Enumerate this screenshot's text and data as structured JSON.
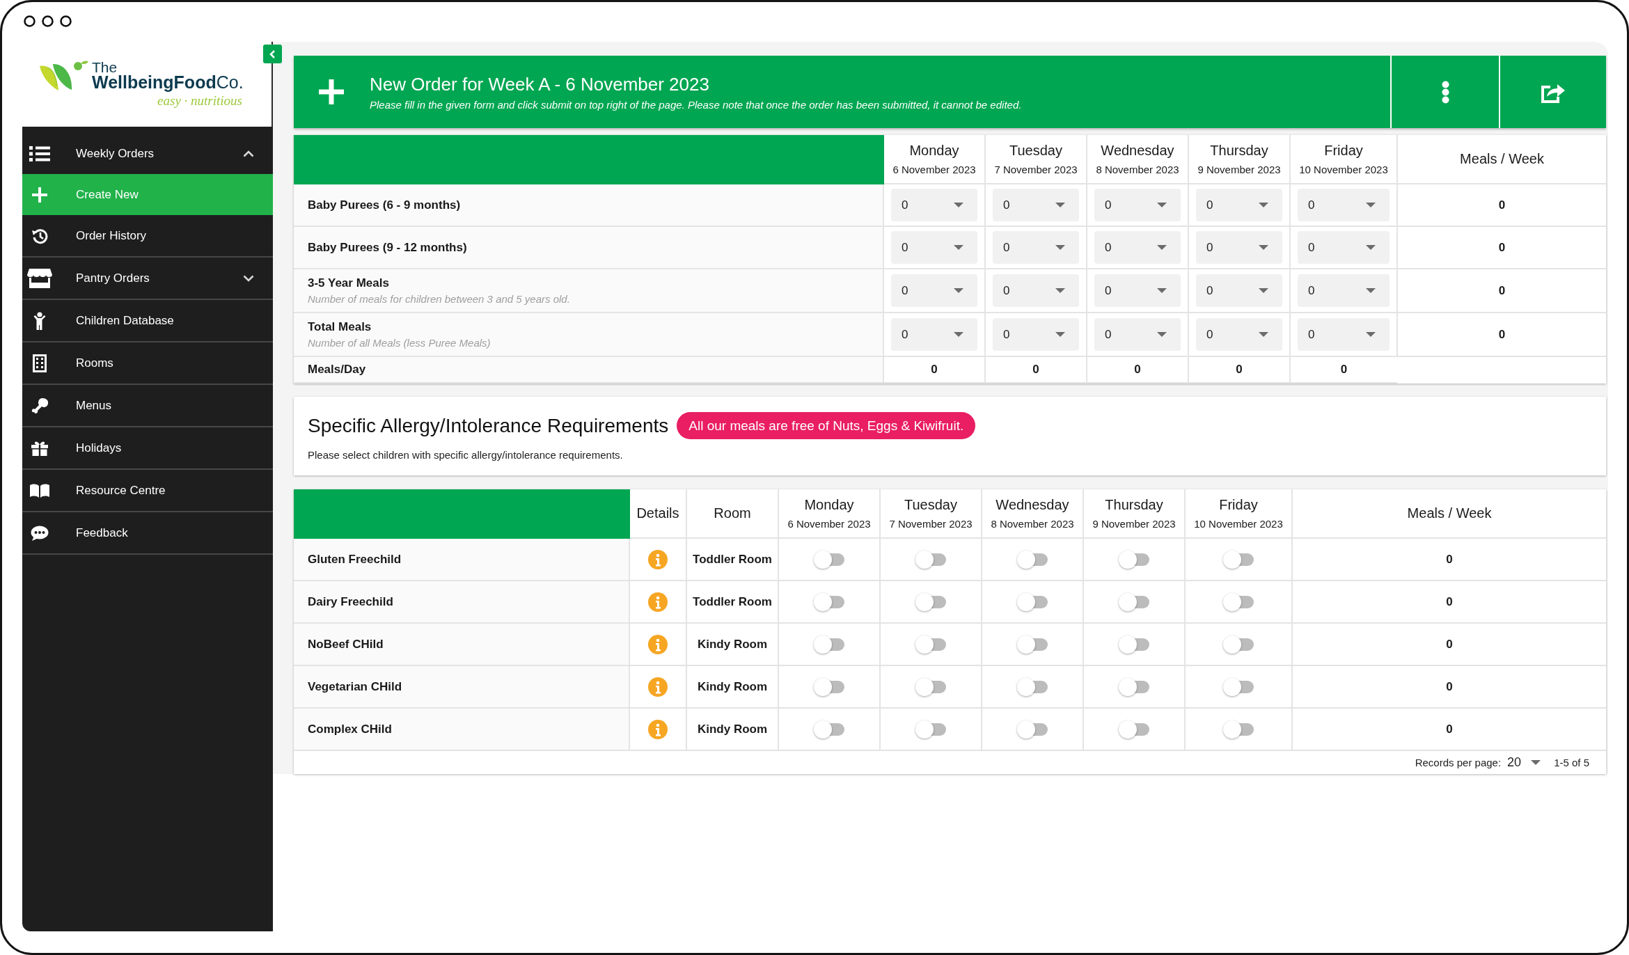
{
  "logo": {
    "name_small": "The",
    "name": "**WellbeingFood**Co.",
    "tagline": "easy · nutritious"
  },
  "sidebar": {
    "items": [
      {
        "kind": "group",
        "label": "Weekly Orders",
        "selected": false,
        "expanded": true,
        "children": [
          {
            "label": "Create New",
            "selected": true
          },
          {
            "label": "Order History",
            "selected": false
          }
        ]
      },
      {
        "kind": "group",
        "label": "Pantry Orders",
        "selected": false,
        "expanded": false
      },
      {
        "kind": "link",
        "label": "Children Database",
        "selected": false
      },
      {
        "kind": "link",
        "label": "Rooms",
        "selected": false
      },
      {
        "kind": "link",
        "label": "Menus",
        "selected": false
      },
      {
        "kind": "link",
        "label": "Holidays",
        "selected": false
      },
      {
        "kind": "link",
        "label": "Resource Centre",
        "selected": false
      },
      {
        "kind": "link",
        "label": "Feedback",
        "selected": false
      }
    ]
  },
  "header": {
    "title": "New Order for Week A - 6 November 2023",
    "subtitle": "Please fill in the given form and click submit on top right of the page. Please note that once the order has been submitted, it cannot be edited."
  },
  "order_table": {
    "columns": [
      {
        "day": "Monday",
        "date": "6 November 2023"
      },
      {
        "day": "Tuesday",
        "date": "7 November 2023"
      },
      {
        "day": "Wednesday",
        "date": "8 November 2023"
      },
      {
        "day": "Thursday",
        "date": "9 November 2023"
      },
      {
        "day": "Friday",
        "date": "10 November 2023"
      }
    ],
    "total_heading": "Meals / Week",
    "rows": [
      {
        "label": "Baby Purees (6 - 9 months)",
        "values": [
          "0",
          "0",
          "0",
          "0",
          "0"
        ],
        "total": "0"
      },
      {
        "label": "Baby Purees (9 - 12 months)",
        "values": [
          "0",
          "0",
          "0",
          "0",
          "0"
        ],
        "total": "0"
      },
      {
        "label": "3-5 Year Meals",
        "note": "Number of meals for children between 3 and 5 years old.",
        "values": [
          "0",
          "0",
          "0",
          "0",
          "0"
        ],
        "total": "0"
      },
      {
        "label": "Total Meals",
        "note": "Number of all Meals (less Puree Meals)",
        "values": [
          "0",
          "0",
          "0",
          "0",
          "0"
        ],
        "total": "0"
      }
    ],
    "summary": {
      "label": "Meals/Day",
      "values": [
        "0",
        "0",
        "0",
        "0",
        "0"
      ]
    }
  },
  "allergy_panel": {
    "title": "Specific Allergy/Intolerance Requirements",
    "badge": "All our meals are free of Nuts, Eggs & Kiwifruit.",
    "subtitle": "Please select children with specific allergy/intolerance requirements."
  },
  "children_table": {
    "details_heading": "Details",
    "room_heading": "Room",
    "columns": [
      {
        "day": "Monday",
        "date": "6 November 2023"
      },
      {
        "day": "Tuesday",
        "date": "7 November 2023"
      },
      {
        "day": "Wednesday",
        "date": "8 November 2023"
      },
      {
        "day": "Thursday",
        "date": "9 November 2023"
      },
      {
        "day": "Friday",
        "date": "10 November 2023"
      }
    ],
    "total_heading": "Meals / Week",
    "rows": [
      {
        "name": "Gluten Freechild",
        "room": "Toddler Room",
        "toggles": [
          {
            "on": false
          },
          {
            "on": false
          },
          {
            "on": false
          },
          {
            "on": false
          },
          {
            "on": false
          }
        ],
        "total": "0"
      },
      {
        "name": "Dairy Freechild",
        "room": "Toddler Room",
        "toggles": [
          {
            "on": false
          },
          {
            "on": false
          },
          {
            "on": false
          },
          {
            "on": false
          },
          {
            "on": false
          }
        ],
        "total": "0"
      },
      {
        "name": "NoBeef CHild",
        "room": "Kindy Room",
        "toggles": [
          {
            "on": false
          },
          {
            "on": false
          },
          {
            "on": false
          },
          {
            "on": false
          },
          {
            "on": false
          }
        ],
        "total": "0"
      },
      {
        "name": "Vegetarian CHild",
        "room": "Kindy Room",
        "toggles": [
          {
            "on": false
          },
          {
            "on": false
          },
          {
            "on": false
          },
          {
            "on": false
          },
          {
            "on": false
          }
        ],
        "total": "0"
      },
      {
        "name": "Complex CHild",
        "room": "Kindy Room",
        "toggles": [
          {
            "on": false
          },
          {
            "on": false
          },
          {
            "on": false
          },
          {
            "on": false
          },
          {
            "on": false
          }
        ],
        "total": "0"
      }
    ],
    "pagination": {
      "label": "Records per page:",
      "per_page": "20",
      "range": "1-5 of 5"
    }
  }
}
